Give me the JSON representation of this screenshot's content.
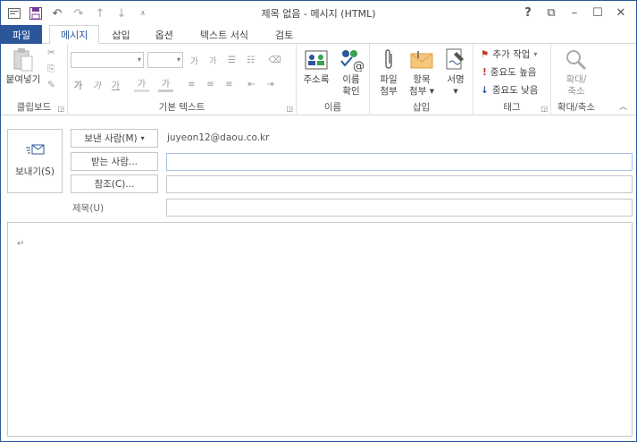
{
  "window": {
    "title": "제목 없음 - 메시지 (HTML)",
    "help": "?",
    "restore_ribbon": "⧉",
    "minimize": "–",
    "maximize": "☐",
    "close": "✕"
  },
  "quick_access": [
    {
      "icon": "outlook-icon"
    },
    {
      "icon": "save-icon"
    },
    {
      "icon": "undo-icon"
    },
    {
      "icon": "redo-icon"
    },
    {
      "icon": "up-arrow-icon"
    },
    {
      "icon": "down-arrow-icon"
    },
    {
      "icon": "customize-icon"
    }
  ],
  "tabs": [
    {
      "label": "파일"
    },
    {
      "label": "메시지"
    },
    {
      "label": "삽입"
    },
    {
      "label": "옵션"
    },
    {
      "label": "텍스트 서식"
    },
    {
      "label": "검토"
    }
  ],
  "ribbon": {
    "clipboard": {
      "paste": "붙여넣기",
      "group": "클립보드"
    },
    "basic_text": {
      "group": "기본 텍스트",
      "grow": "가",
      "shrink": "가",
      "bold": "가",
      "italic": "가",
      "underline": "가",
      "highlight": "가",
      "font_color": "가"
    },
    "names": {
      "address_book": "주소록",
      "check_names_1": "이름",
      "check_names_2": "확인",
      "group": "이름"
    },
    "include": {
      "attach_file_1": "파일",
      "attach_file_2": "첨부",
      "attach_item_1": "항목",
      "attach_item_2": "첨부",
      "signature": "서명",
      "group": "삽입"
    },
    "tags": {
      "follow_up": "추가 작업",
      "high_importance": "중요도 높음",
      "low_importance": "중요도 낮음",
      "group": "태그"
    },
    "zoom": {
      "label_1": "확대/",
      "label_2": "축소",
      "group": "확대/축소"
    }
  },
  "compose": {
    "send": "보내기(S)",
    "from_button": "보낸 사람(M)",
    "from_value": "juyeon12@daou.co.kr",
    "to_button": "받는 사람...",
    "cc_button": "참조(C)...",
    "subject_label": "제목(U)",
    "to_value": "",
    "cc_value": "",
    "subject_value": "",
    "paragraph_mark": "↵"
  },
  "colors": {
    "accent": "#2b579a",
    "flag_red": "#c0392b",
    "low_blue": "#2b579a"
  }
}
